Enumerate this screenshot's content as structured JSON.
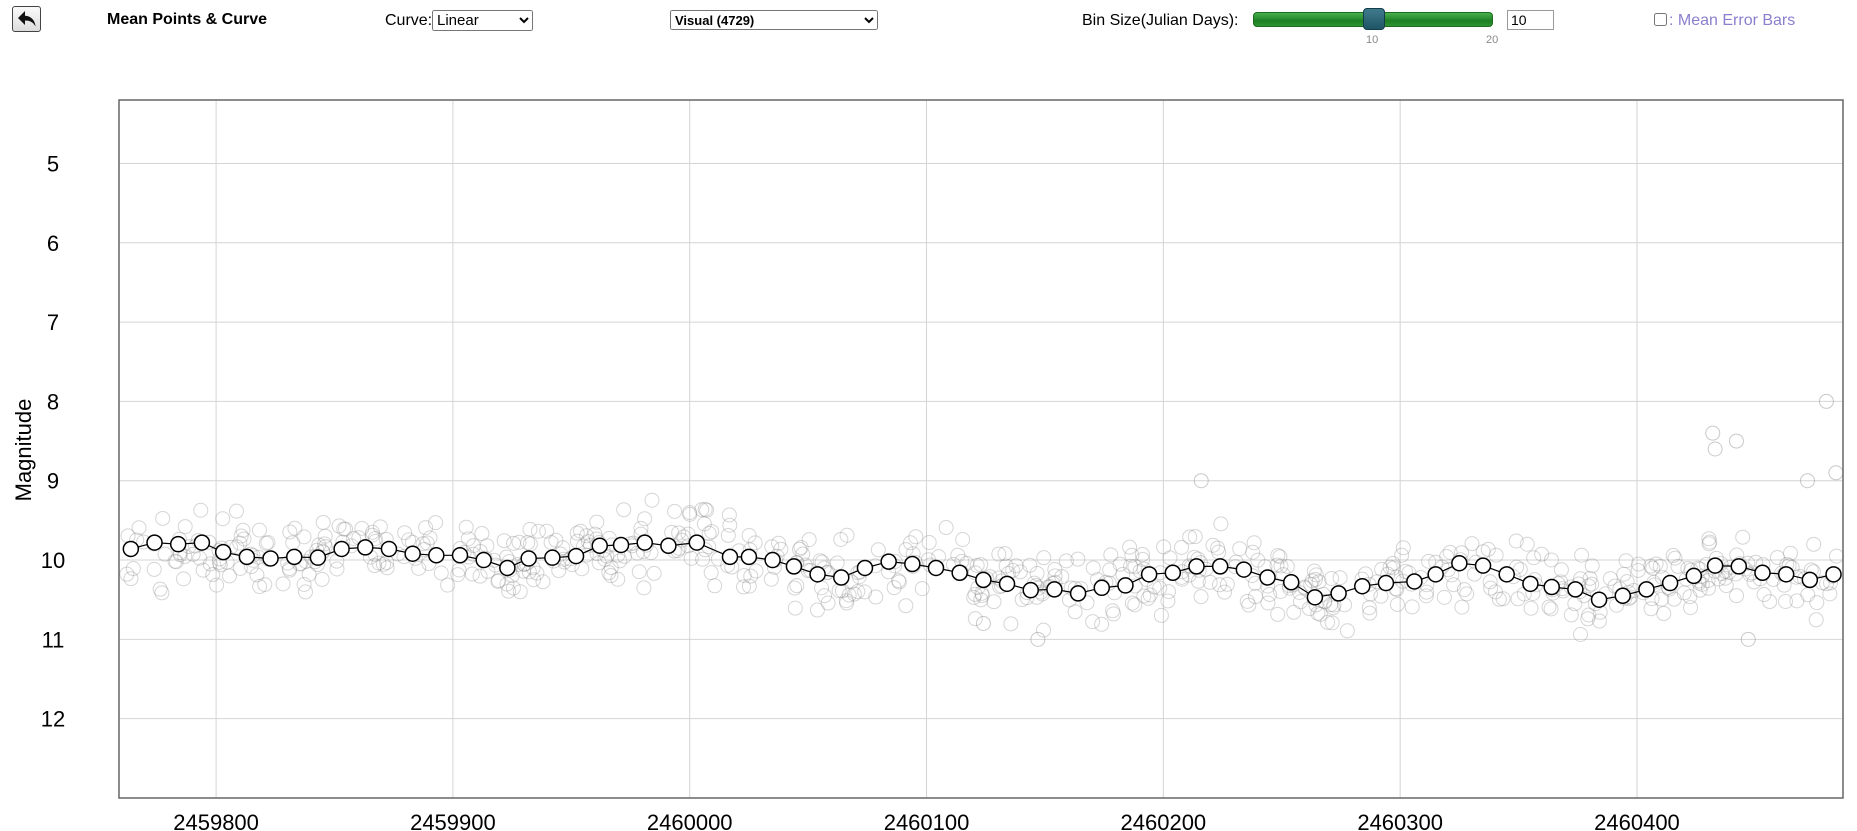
{
  "toolbar": {
    "mode_title": "Mean Points & Curve",
    "curve_label": "Curve:",
    "curve_value": "Linear",
    "band_value": "Visual (4729)",
    "bin_label": "Bin Size(Julian Days):",
    "slider_value": 10,
    "slider_min_label": "10",
    "slider_max_label": "20",
    "bin_value": "10",
    "error_bars_label": ": Mean Error Bars",
    "error_bars_checked": false
  },
  "colors": {
    "slider_fill": "#2e9432",
    "slider_thumb": "#1f5566",
    "error_bars_label": "#8a7fcf",
    "raw_points": "#888888",
    "mean_curve": "#000000"
  },
  "icons": {
    "back": "back-arrow-icon"
  },
  "chart_data": {
    "type": "scatter",
    "xlabel": "",
    "ylabel": "Magnitude",
    "xlim": [
      2459759,
      2460487
    ],
    "ylim": [
      4.2,
      13.0
    ],
    "y_inverted": true,
    "x_ticks": [
      "2459800",
      "2459900",
      "2460000",
      "2460100",
      "2460200",
      "2460300",
      "2460400"
    ],
    "y_ticks": [
      "5",
      "6",
      "7",
      "8",
      "9",
      "10",
      "11",
      "12"
    ],
    "grid": true,
    "series": [
      {
        "role": "mean",
        "x": [
          2459764,
          2459774,
          2459784,
          2459794,
          2459803,
          2459813,
          2459823,
          2459833,
          2459843,
          2459853,
          2459863,
          2459873,
          2459883,
          2459893,
          2459903,
          2459913,
          2459923,
          2459932,
          2459942,
          2459952,
          2459962,
          2459971,
          2459981,
          2459991,
          2460003,
          2460017,
          2460025,
          2460035,
          2460044,
          2460054,
          2460064,
          2460074,
          2460084,
          2460094,
          2460104,
          2460114,
          2460124,
          2460134,
          2460144,
          2460154,
          2460164,
          2460174,
          2460184,
          2460194,
          2460204,
          2460214,
          2460224,
          2460234,
          2460244,
          2460254,
          2460264,
          2460274,
          2460284,
          2460294,
          2460306,
          2460315,
          2460325,
          2460335,
          2460345,
          2460355,
          2460364,
          2460374,
          2460384,
          2460394,
          2460404,
          2460414,
          2460424,
          2460433,
          2460443,
          2460453,
          2460463,
          2460473,
          2460483
        ],
        "y": [
          9.86,
          9.78,
          9.8,
          9.78,
          9.9,
          9.96,
          9.98,
          9.96,
          9.97,
          9.86,
          9.84,
          9.86,
          9.92,
          9.94,
          9.94,
          10.0,
          10.1,
          9.98,
          9.97,
          9.95,
          9.82,
          9.81,
          9.78,
          9.82,
          9.78,
          9.96,
          9.96,
          10.0,
          10.08,
          10.18,
          10.22,
          10.1,
          10.02,
          10.05,
          10.1,
          10.16,
          10.25,
          10.3,
          10.38,
          10.37,
          10.42,
          10.35,
          10.32,
          10.18,
          10.16,
          10.08,
          10.08,
          10.12,
          10.22,
          10.28,
          10.47,
          10.42,
          10.33,
          10.29,
          10.27,
          10.18,
          10.04,
          10.07,
          10.18,
          10.3,
          10.34,
          10.37,
          10.5,
          10.45,
          10.37,
          10.29,
          10.2,
          10.07,
          10.08,
          10.16,
          10.18,
          10.25,
          10.18
        ]
      }
    ],
    "raw_observations": {
      "count": 4729,
      "typical_magnitude_range": [
        9.2,
        11.0
      ],
      "outliers": [
        [
          2460432,
          8.4
        ],
        [
          2460433,
          8.6
        ],
        [
          2460442,
          8.5
        ],
        [
          2460480,
          8.0
        ],
        [
          2460472,
          9.0
        ],
        [
          2460484,
          8.9
        ],
        [
          2460216,
          9.0
        ],
        [
          2460147,
          11.0
        ],
        [
          2460124,
          10.8
        ],
        [
          2460447,
          11.0
        ]
      ]
    }
  }
}
